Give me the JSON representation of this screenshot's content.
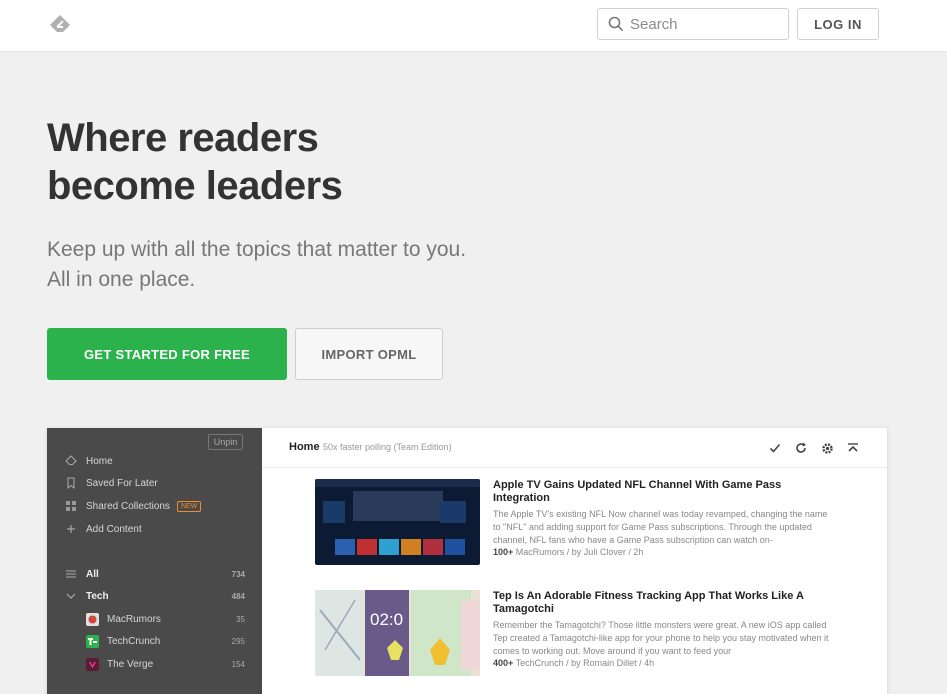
{
  "header": {
    "search_placeholder": "Search",
    "login_label": "LOG IN"
  },
  "hero": {
    "title_line1": "Where readers",
    "title_line2": "become leaders",
    "subtitle": "Keep up with all the topics that matter to you. All in one place.",
    "cta_label": "GET STARTED FOR FREE",
    "opml_label": "IMPORT OPML"
  },
  "preview": {
    "sidebar": {
      "unpin_label": "Unpin",
      "nav": [
        {
          "label": "Home",
          "icon": "feedly-logo-icon"
        },
        {
          "label": "Saved For Later",
          "icon": "bookmark-icon"
        },
        {
          "label": "Shared Collections",
          "icon": "collections-icon",
          "badge": "NEW"
        },
        {
          "label": "Add Content",
          "icon": "plus-icon"
        }
      ],
      "all": {
        "label": "All",
        "count": "734"
      },
      "tech": {
        "label": "Tech",
        "count": "484"
      },
      "sources": [
        {
          "label": "MacRumors",
          "count": "35",
          "icon": "macrumors-icon",
          "color": "#e0e0e0"
        },
        {
          "label": "TechCrunch",
          "count": "295",
          "icon": "techcrunch-icon",
          "color": "#2bb24c"
        },
        {
          "label": "The Verge",
          "count": "154",
          "icon": "verge-icon",
          "color": "#e5127d"
        }
      ]
    },
    "main": {
      "title": "Home",
      "subtitle": "50x faster polling (Team Edition)",
      "articles": [
        {
          "title": "Apple TV Gains Updated NFL Channel With Game Pass Integration",
          "body": "The Apple TV's existing NFL Now channel was today revamped, changing the name to \"NFL\" and adding support for Game Pass subscriptions. Through the updated channel, NFL fans who have a Game Pass subscription can watch on-",
          "count": "100+",
          "meta": "MacRumors / by Juli Clover / 2h"
        },
        {
          "title": "Tep Is An Adorable Fitness Tracking App That Works Like A Tamagotchi",
          "body": "Remember the Tamagotchi? Those little monsters were great. A new iOS app called Tep created a Tamagotchi-like app for your phone to help you stay motivated when it comes to working out. Move around if you want to feed your",
          "count": "400+",
          "meta": "TechCrunch / by Romain Dillet / 4h",
          "thumb_time": "02:0"
        }
      ]
    }
  }
}
